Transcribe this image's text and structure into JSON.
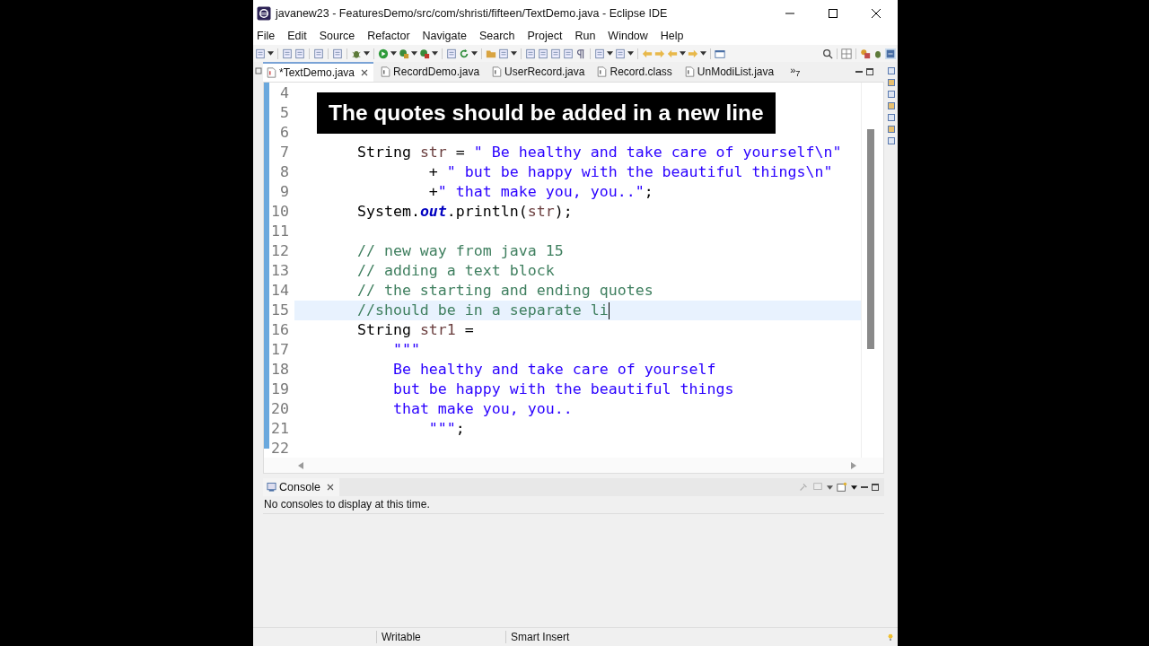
{
  "window": {
    "title": "javanew23 - FeaturesDemo/src/com/shristi/fifteen/TextDemo.java - Eclipse IDE"
  },
  "menu": [
    "File",
    "Edit",
    "Source",
    "Refactor",
    "Navigate",
    "Search",
    "Project",
    "Run",
    "Window",
    "Help"
  ],
  "tabs": [
    {
      "label": "*TextDemo.java",
      "selected": true,
      "closable": true
    },
    {
      "label": "RecordDemo.java",
      "selected": false,
      "closable": false
    },
    {
      "label": "UserRecord.java",
      "selected": false,
      "closable": false
    },
    {
      "label": "Record.class",
      "selected": false,
      "closable": false
    },
    {
      "label": "UnModiList.java",
      "selected": false,
      "closable": false
    }
  ],
  "tabs_overflow": "»$_{7}$",
  "editor": {
    "lines": [
      {
        "number": "4",
        "current": false
      },
      {
        "number": "5",
        "current": false
      },
      {
        "number": "6",
        "current": false
      },
      {
        "number": "7",
        "current": false,
        "tokens": [
          {
            "kind": "plain",
            "text": "       String "
          },
          {
            "kind": "variable",
            "text": "str"
          },
          {
            "kind": "plain",
            "text": " = "
          },
          {
            "kind": "string",
            "text": "\" Be healthy and take care of yourself\\n\""
          }
        ]
      },
      {
        "number": "8",
        "current": false,
        "tokens": [
          {
            "kind": "plain",
            "text": "               + "
          },
          {
            "kind": "string",
            "text": "\" but be happy with the beautiful things\\n\""
          }
        ]
      },
      {
        "number": "9",
        "current": false,
        "tokens": [
          {
            "kind": "plain",
            "text": "               +"
          },
          {
            "kind": "string",
            "text": "\" that make you, you..\""
          },
          {
            "kind": "plain",
            "text": ";"
          }
        ]
      },
      {
        "number": "10",
        "current": false,
        "tokens": [
          {
            "kind": "plain",
            "text": "       System."
          },
          {
            "kind": "field",
            "text": "out"
          },
          {
            "kind": "plain",
            "text": ".println("
          },
          {
            "kind": "variable",
            "text": "str"
          },
          {
            "kind": "plain",
            "text": ");"
          }
        ]
      },
      {
        "number": "11",
        "current": false
      },
      {
        "number": "12",
        "current": false,
        "tokens": [
          {
            "kind": "comment",
            "text": "       // new way from java 15"
          }
        ]
      },
      {
        "number": "13",
        "current": false,
        "tokens": [
          {
            "kind": "comment",
            "text": "       // adding a text block"
          }
        ]
      },
      {
        "number": "14",
        "current": false,
        "tokens": [
          {
            "kind": "comment",
            "text": "       // the starting and ending quotes"
          }
        ]
      },
      {
        "number": "15",
        "current": true,
        "tokens": [
          {
            "kind": "comment",
            "text": "       //should be in a separate li"
          }
        ]
      },
      {
        "number": "16",
        "current": false,
        "tokens": [
          {
            "kind": "plain",
            "text": "       String "
          },
          {
            "kind": "variable",
            "text": "str1"
          },
          {
            "kind": "plain",
            "text": " ="
          }
        ]
      },
      {
        "number": "17",
        "current": false,
        "tokens": [
          {
            "kind": "string",
            "text": "           \"\"\""
          }
        ]
      },
      {
        "number": "18",
        "current": false,
        "tokens": [
          {
            "kind": "string",
            "text": "           Be healthy and take care of yourself"
          }
        ]
      },
      {
        "number": "19",
        "current": false,
        "tokens": [
          {
            "kind": "string",
            "text": "           but be happy with the beautiful things"
          }
        ]
      },
      {
        "number": "20",
        "current": false,
        "tokens": [
          {
            "kind": "string",
            "text": "           that make you, you.."
          }
        ]
      },
      {
        "number": "21",
        "current": false,
        "tokens": [
          {
            "kind": "string",
            "text": "               \"\"\""
          },
          {
            "kind": "plain",
            "text": ";"
          }
        ]
      },
      {
        "number": "22",
        "current": false
      }
    ]
  },
  "caption": "The quotes should be added in a new line",
  "console": {
    "tab": "Console",
    "message": "No consoles to display at this time."
  },
  "status_bar": [
    "Writable",
    "Smart Insert"
  ]
}
